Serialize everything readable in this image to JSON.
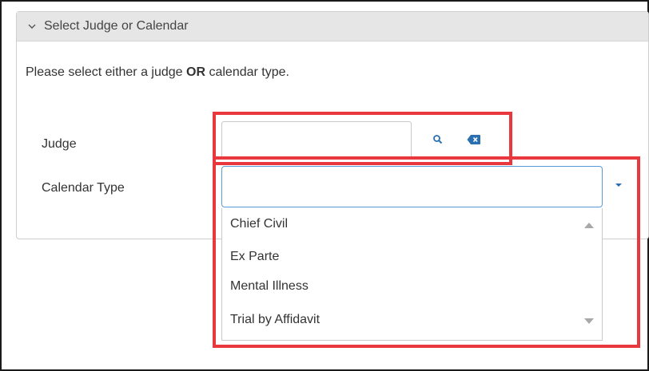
{
  "panel": {
    "title": "Select Judge or Calendar",
    "instructions": {
      "prefix": "Please select either a judge ",
      "emphasis": "OR",
      "suffix": " calendar type."
    }
  },
  "form": {
    "judge_label": "Judge",
    "judge_value": "",
    "calendar_type_label": "Calendar Type",
    "calendar_type_value": ""
  },
  "calendar_options": [
    "Chief Civil",
    "Ex Parte",
    "Mental Illness",
    "Trial by Affidavit"
  ],
  "icons": {
    "panel_toggle": "chevron-down-icon",
    "judge_search": "search-icon",
    "judge_clear": "backspace-icon",
    "calendar_caret": "caret-down-icon",
    "scroll_up": "scroll-up-icon",
    "scroll_down": "scroll-down-icon"
  },
  "colors": {
    "header_bg": "#e6e6e6",
    "focus_border": "#5a9ad6",
    "icon_blue": "#2a6fb0",
    "annotation_red": "#e8383d"
  }
}
